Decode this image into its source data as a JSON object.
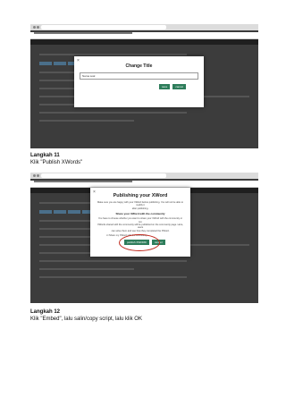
{
  "screenshot1": {
    "dialog_title": "Change Title",
    "input_value": "Nama soal",
    "buttons": [
      "save",
      "cancel"
    ]
  },
  "step11": {
    "label": "Langkah 11",
    "text": "Klik \"Publish XWords\""
  },
  "screenshot2": {
    "dialog_title": "Publishing your XWord",
    "lines": [
      "Make sure you are happy with your XWord before publishing. You will not be able to modify it",
      "after publishing."
    ],
    "subheading": "Share your XWord with the community",
    "community_lines": [
      "You have to choose whether you want to share your XWord with the community or not.",
      "XWords shared with the community will be published on the community page. Here, users",
      "can solve them and see how they completed the XWord."
    ],
    "checkbox_label": "Share my XWord with the community",
    "buttons": [
      "publish XWORD",
      "cancel"
    ]
  },
  "step12": {
    "label": "Langkah 12",
    "text": "Klik \"Embed\", lalu salin/copy script, lalu klik OK"
  }
}
